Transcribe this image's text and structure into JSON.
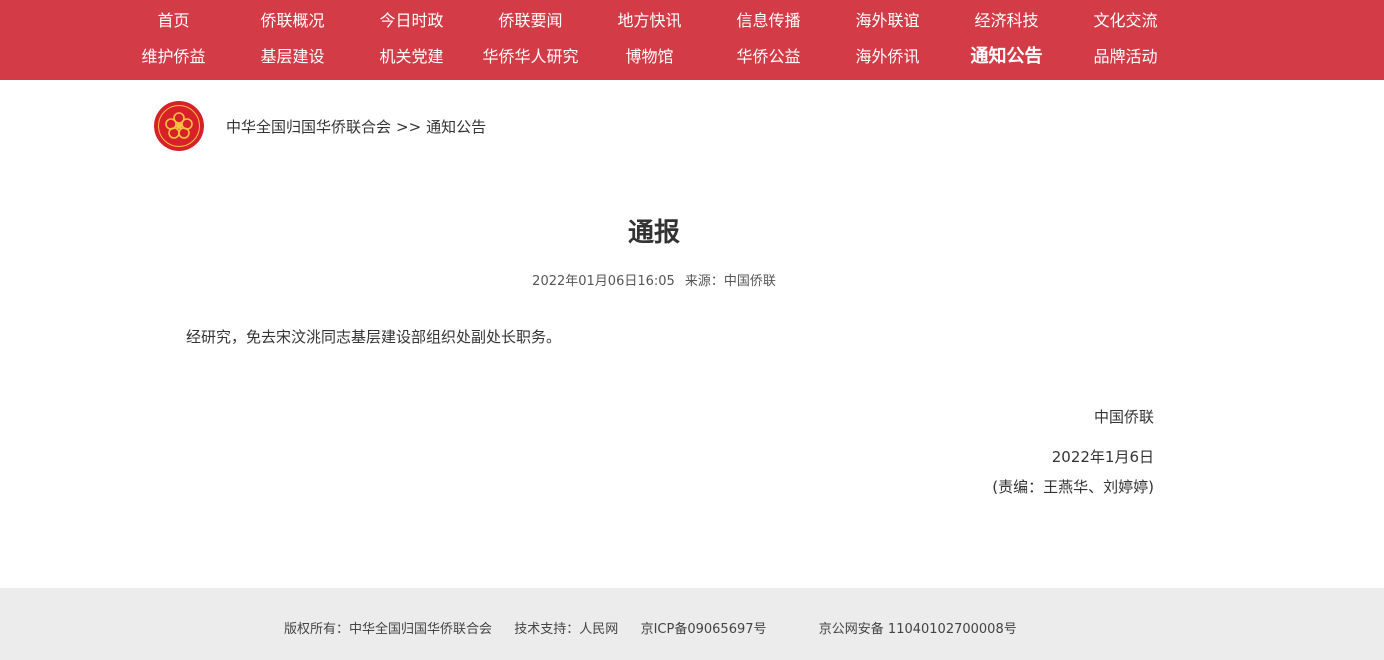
{
  "nav": {
    "row1": [
      "首页",
      "侨联概况",
      "今日时政",
      "侨联要闻",
      "地方快讯",
      "信息传播",
      "海外联谊",
      "经济科技",
      "文化交流"
    ],
    "row2": [
      "维护侨益",
      "基层建设",
      "机关党建",
      "华侨华人研究",
      "博物馆",
      "华侨公益",
      "海外侨讯",
      "通知公告",
      "品牌活动"
    ],
    "active": "通知公告"
  },
  "breadcrumb": {
    "home": "中华全国归国华侨联合会",
    "separator": ">>",
    "current": "通知公告"
  },
  "article": {
    "title": "通报",
    "datetime": "2022年01月06日16:05",
    "source": "来源：中国侨联",
    "body": "经研究，免去宋汶洮同志基层建设部组织处副处长职务。",
    "signature_org": "中国侨联",
    "signature_date": "2022年1月6日",
    "editor": "(责编：王燕华、刘婷婷)"
  },
  "footer": {
    "copyright": "版权所有：中华全国归国华侨联合会",
    "tech_support": "技术支持：人民网",
    "icp": "京ICP备09065697号",
    "police": "京公网安备 11040102700008号"
  },
  "colors": {
    "nav_bg": "#d33b46",
    "footer_bg": "#ececec",
    "logo_red": "#d8202b",
    "logo_gold": "#f6c23e"
  },
  "icons": {
    "logo": "acfroc-emblem-icon"
  }
}
